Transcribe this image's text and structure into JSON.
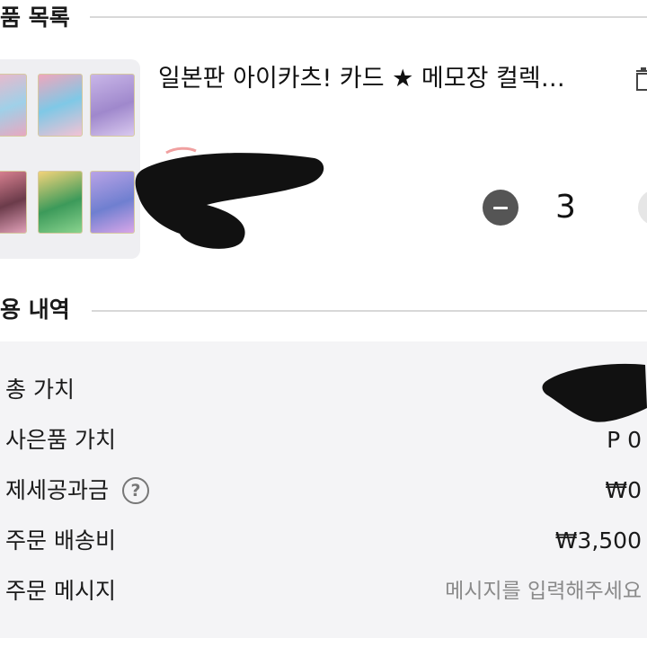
{
  "product_section": {
    "title": "품 목록",
    "item": {
      "title": "일본판 아이카츠! 카드 ★ 메모장 컬렉…",
      "quantity": "3"
    }
  },
  "summary_section": {
    "title": "용 내역",
    "rows": [
      {
        "label": "총 가치",
        "value": ""
      },
      {
        "label": "사은품 가치",
        "value": "P 0"
      },
      {
        "label": "제세공과금",
        "value": "₩0"
      },
      {
        "label": "주문 배송비",
        "value": "₩3,500"
      },
      {
        "label": "주문 메시지",
        "placeholder": "메시지를 입력해주세요"
      }
    ]
  },
  "icons": {
    "trash": "trash-icon",
    "help": "question-circle-icon",
    "minus": "minus-icon"
  },
  "colors": {
    "accent_minus": "#555555",
    "summary_bg": "#f4f4f6",
    "divider": "#d8d8d8",
    "placeholder": "#8a8a8a"
  }
}
